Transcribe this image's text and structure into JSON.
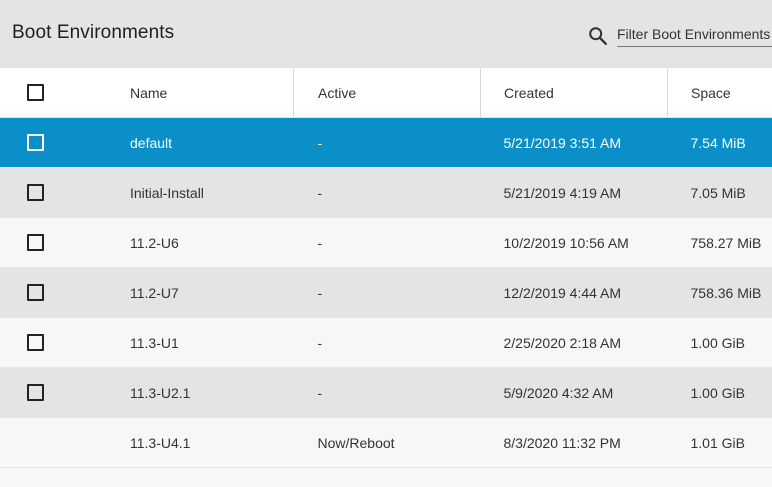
{
  "header": {
    "title": "Boot Environments",
    "search_icon": "search-icon",
    "filter_placeholder": "Filter Boot Environments"
  },
  "table": {
    "columns": [
      "Name",
      "Active",
      "Created",
      "Space"
    ],
    "rows": [
      {
        "name": "default",
        "active": "-",
        "created": "5/21/2019 3:51 AM",
        "space": "7.54 MiB",
        "selected": true,
        "checkbox": true
      },
      {
        "name": "Initial-Install",
        "active": "-",
        "created": "5/21/2019 4:19 AM",
        "space": "7.05 MiB",
        "selected": false,
        "checkbox": true
      },
      {
        "name": "11.2-U6",
        "active": "-",
        "created": "10/2/2019 10:56 AM",
        "space": "758.27 MiB",
        "selected": false,
        "checkbox": true
      },
      {
        "name": "11.2-U7",
        "active": "-",
        "created": "12/2/2019 4:44 AM",
        "space": "758.36 MiB",
        "selected": false,
        "checkbox": true
      },
      {
        "name": "11.3-U1",
        "active": "-",
        "created": "2/25/2020 2:18 AM",
        "space": "1.00 GiB",
        "selected": false,
        "checkbox": true
      },
      {
        "name": "11.3-U2.1",
        "active": "-",
        "created": "5/9/2020 4:32 AM",
        "space": "1.00 GiB",
        "selected": false,
        "checkbox": true
      },
      {
        "name": "11.3-U4.1",
        "active": "Now/Reboot",
        "created": "8/3/2020 11:32 PM",
        "space": "1.01 GiB",
        "selected": false,
        "checkbox": false
      }
    ]
  },
  "colors": {
    "header_bg": "#e4e4e4",
    "selected_row": "#0a8fc8",
    "alt_row": "#e4e4e4"
  }
}
